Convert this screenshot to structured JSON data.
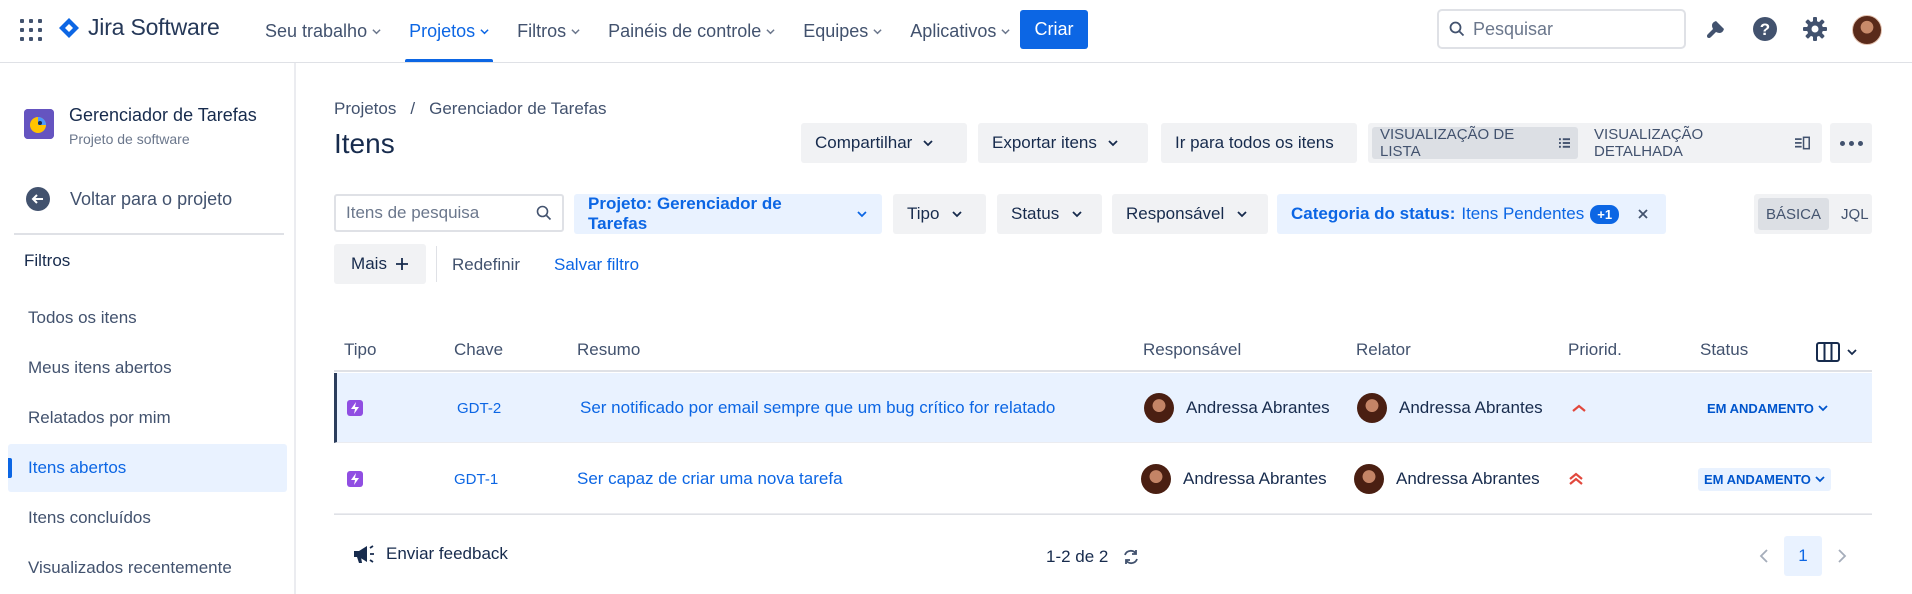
{
  "nav": {
    "logo_text": "Jira Software",
    "items": [
      {
        "label": "Seu trabalho"
      },
      {
        "label": "Projetos"
      },
      {
        "label": "Filtros"
      },
      {
        "label": "Painéis de controle"
      },
      {
        "label": "Equipes"
      },
      {
        "label": "Aplicativos"
      }
    ],
    "active_item": "Projetos",
    "create_label": "Criar",
    "search_placeholder": "Pesquisar",
    "icons": [
      "notifications-icon",
      "help-icon",
      "settings-icon"
    ]
  },
  "sidebar": {
    "project_name": "Gerenciador de Tarefas",
    "project_type": "Projeto de software",
    "back_label": "Voltar para o projeto",
    "section_heading": "Filtros",
    "items": [
      {
        "label": "Todos os itens"
      },
      {
        "label": "Meus itens abertos"
      },
      {
        "label": "Relatados por mim"
      },
      {
        "label": "Itens abertos"
      },
      {
        "label": "Itens concluídos"
      },
      {
        "label": "Visualizados recentemente"
      }
    ],
    "active_item": "Itens abertos"
  },
  "main": {
    "breadcrumb": {
      "root": "Projetos",
      "separator": "/",
      "current": "Gerenciador de Tarefas"
    },
    "title": "Itens",
    "toolbar": {
      "share_label": "Compartilhar",
      "export_label": "Exportar itens",
      "goto_all_label": "Ir para todos os itens",
      "list_view_label": "VISUALIZAÇÃO DE LISTA",
      "detail_view_label": "VISUALIZAÇÃO DETALHADA",
      "active_view": "list"
    },
    "filters": {
      "search_placeholder": "Itens de pesquisa",
      "project_label": "Projeto: Gerenciador de Tarefas",
      "type_label": "Tipo",
      "status_label": "Status",
      "assignee_label": "Responsável",
      "status_category_prefix": "Categoria do status:",
      "status_category_value": "Itens Pendentes",
      "status_category_extra": "+1",
      "basic_label": "BÁSICA",
      "jql_label": "JQL",
      "active_mode": "basic",
      "more_label": "Mais",
      "reset_label": "Redefinir",
      "save_label": "Salvar filtro"
    },
    "table": {
      "columns": [
        "Tipo",
        "Chave",
        "Resumo",
        "Responsável",
        "Relator",
        "Priorid.",
        "Status"
      ],
      "rows": [
        {
          "type_icon": "epic-icon",
          "key": "GDT-2",
          "summary": "Ser notificado por email sempre que um bug crítico for relatado",
          "assignee": "Andressa Abrantes",
          "reporter": "Andressa Abrantes",
          "priority_icon": "priority-medium-icon",
          "status": "EM ANDAMENTO",
          "selected": true
        },
        {
          "type_icon": "epic-icon",
          "key": "GDT-1",
          "summary": "Ser capaz de criar uma nova tarefa",
          "assignee": "Andressa Abrantes",
          "reporter": "Andressa Abrantes",
          "priority_icon": "priority-high-icon",
          "status": "EM ANDAMENTO",
          "selected": false
        }
      ]
    },
    "footer": {
      "feedback_label": "Enviar feedback",
      "page_info": "1-2 de 2",
      "current_page": "1"
    }
  },
  "colors": {
    "accent": "#0c66e4",
    "selected_bg": "#e9f2ff",
    "epic": "#904ee2",
    "priority": "#e2483d"
  }
}
